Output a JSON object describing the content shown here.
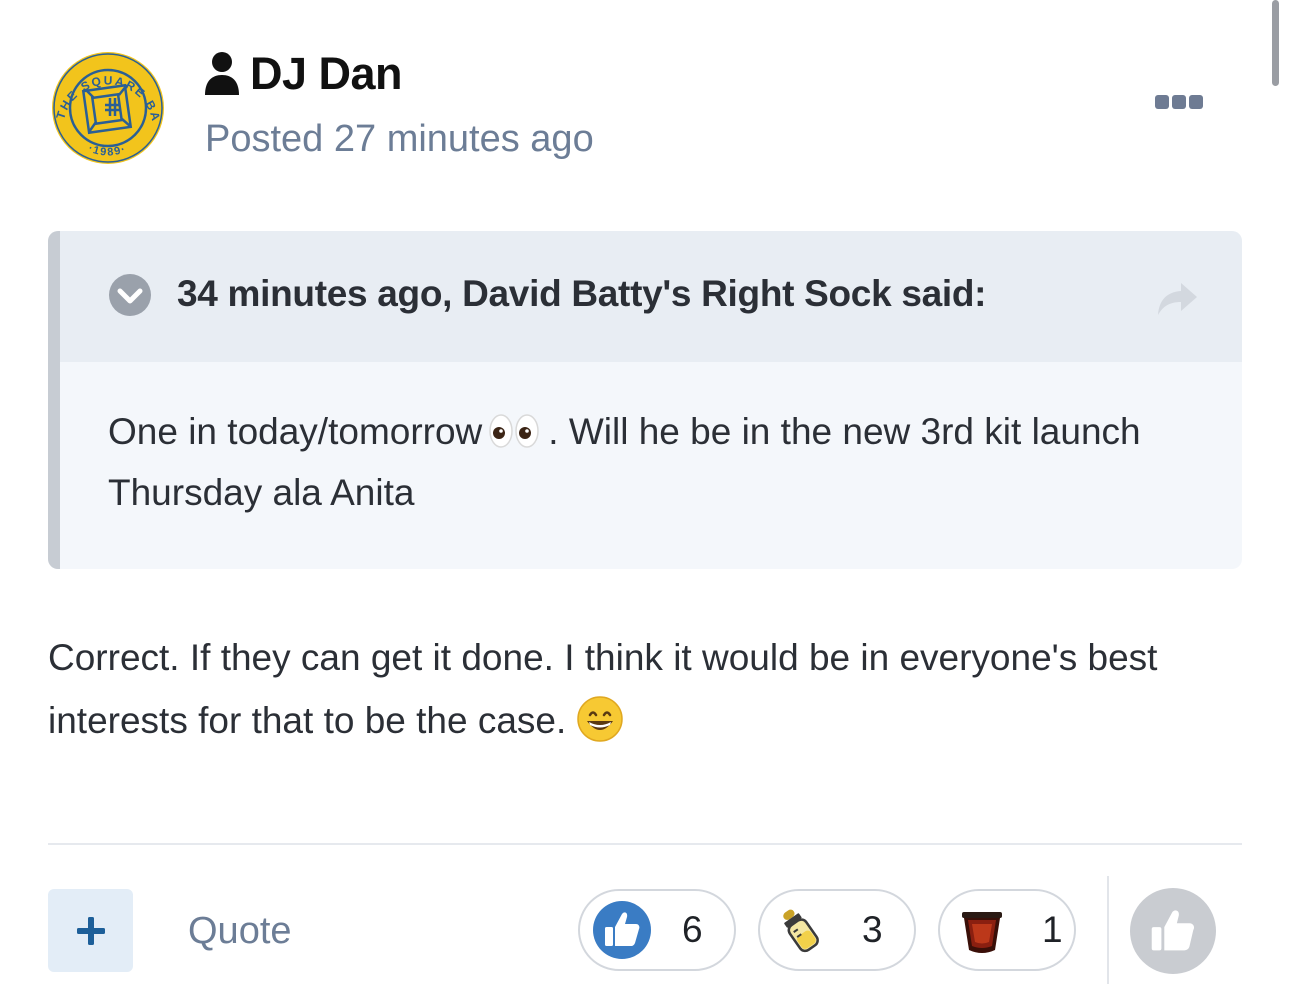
{
  "post": {
    "author": "DJ Dan",
    "posted_time": "Posted 27 minutes ago",
    "avatar": {
      "ring_text": "THE SQUARE BALL",
      "year": "·1989·",
      "icon": "club-crest-logo"
    },
    "menu_icon": "more-options-icon",
    "quote": {
      "citation": "34 minutes ago, David Batty's Right Sock said:",
      "text_before_emoji": "One in today/tomorrow",
      "emoji": "eyes-emoji",
      "text_after_emoji": ". Will he be in the new 3rd kit launch Thursday ala Anita"
    },
    "body": {
      "text": "Correct. If they can get it done. I think it would be in everyone's best interests for that to be the case.",
      "emoji": "grinning-face-emoji"
    }
  },
  "footer": {
    "plus_icon": "plus-icon",
    "quote_label": "Quote",
    "reactions": [
      {
        "icon": "like-thumb-icon",
        "count": "6"
      },
      {
        "icon": "baby-bottle-icon",
        "count": "3"
      },
      {
        "icon": "dark-cup-icon",
        "count": "1"
      }
    ],
    "react_icon": "thumbs-up-icon"
  },
  "colors": {
    "accent_blue": "#3a7cc4",
    "muted_text": "#6c7d96",
    "quote_background": "#f4f7fb",
    "quote_header": "#e8edf3",
    "crest_yellow": "#f2c41c"
  }
}
